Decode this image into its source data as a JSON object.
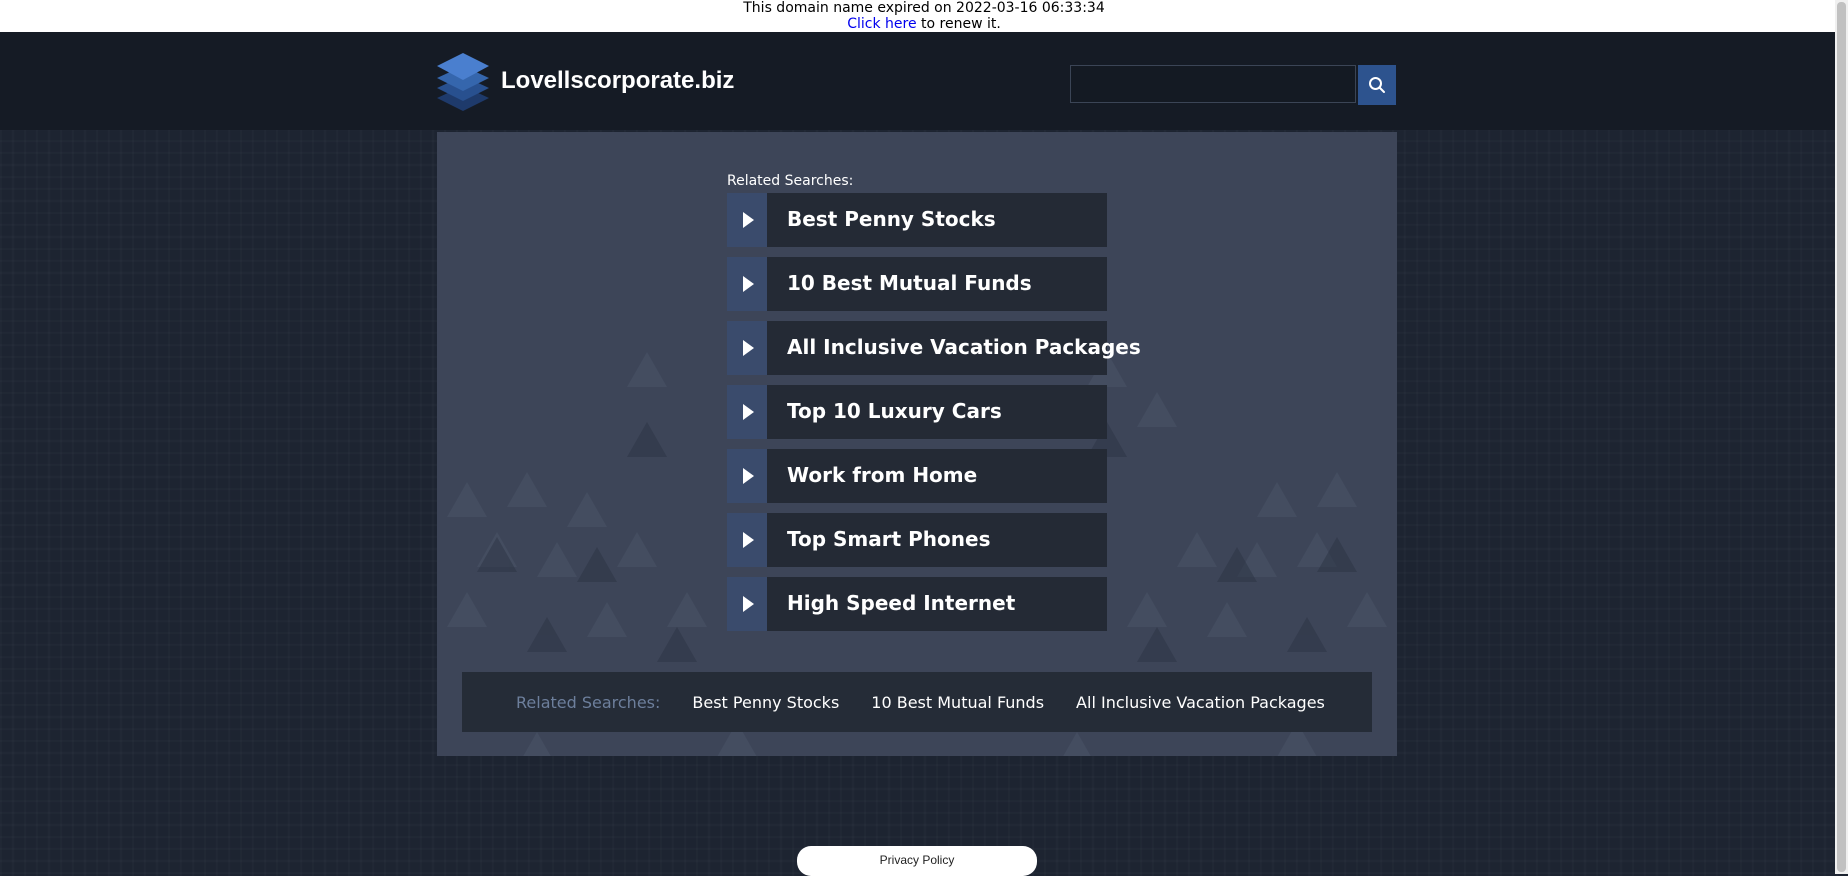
{
  "expiry_notice": {
    "text": "This domain name expired on 2022-03-16 06:33:34",
    "link_text": "Click here",
    "after_link": " to renew it."
  },
  "header": {
    "site_title": "Lovellscorporate.biz",
    "search_placeholder": "",
    "search_icon": "search-icon",
    "logo_icon": "layers-icon"
  },
  "related_searches": {
    "label": "Related Searches:",
    "items": [
      "Best Penny Stocks",
      "10 Best Mutual Funds",
      "All Inclusive Vacation Packages",
      "Top 10 Luxury Cars",
      "Work from Home",
      "Top Smart Phones",
      "High Speed Internet"
    ]
  },
  "bottom_bar": {
    "label": "Related Searches:",
    "links": [
      "Best Penny Stocks",
      "10 Best Mutual Funds",
      "All Inclusive Vacation Packages"
    ]
  },
  "footer": {
    "privacy_label": "Privacy Policy"
  },
  "colors": {
    "page_bg": "#1d2431",
    "header_bg": "#151b25",
    "panel_bg": "#3d4558",
    "item_bg": "#242a35",
    "arrow_bg": "#3a4b6c",
    "accent": "#2d538e",
    "muted_label": "#6d7f9c"
  }
}
